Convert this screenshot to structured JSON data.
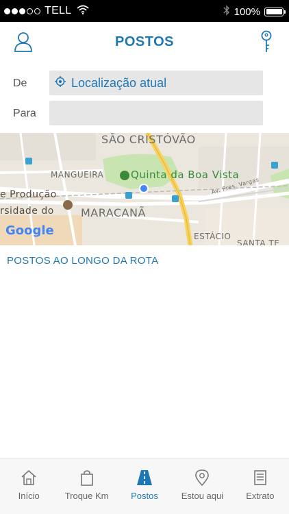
{
  "status_bar": {
    "carrier": "TELL",
    "battery": "100%"
  },
  "header": {
    "title": "POSTOS"
  },
  "route": {
    "from_label": "De",
    "from_value": "Localização atual",
    "to_label": "Para",
    "to_value": ""
  },
  "map": {
    "labels": {
      "sao_cristovao": "SÃO CRISTÓVÃO",
      "mangueira": "MANGUEIRA",
      "quinta": "Quinta da Boa Vista",
      "producao": "e Produção",
      "versidade": "rsidade do",
      "maracana": "MARACANÃ",
      "estacio": "ESTÁCIO",
      "santa": "SANTA TE",
      "av_vargas": "Av. Pres. Vargas",
      "google": "Google"
    }
  },
  "section": {
    "title": "POSTOS AO LONGO DA ROTA"
  },
  "tabs": [
    {
      "label": "Início",
      "icon": "home-icon"
    },
    {
      "label": "Troque Km",
      "icon": "shopping-bag-icon"
    },
    {
      "label": "Postos",
      "icon": "road-icon",
      "active": true
    },
    {
      "label": "Estou aqui",
      "icon": "location-pin-icon"
    },
    {
      "label": "Extrato",
      "icon": "document-icon"
    }
  ],
  "colors": {
    "accent": "#1f78b4"
  }
}
